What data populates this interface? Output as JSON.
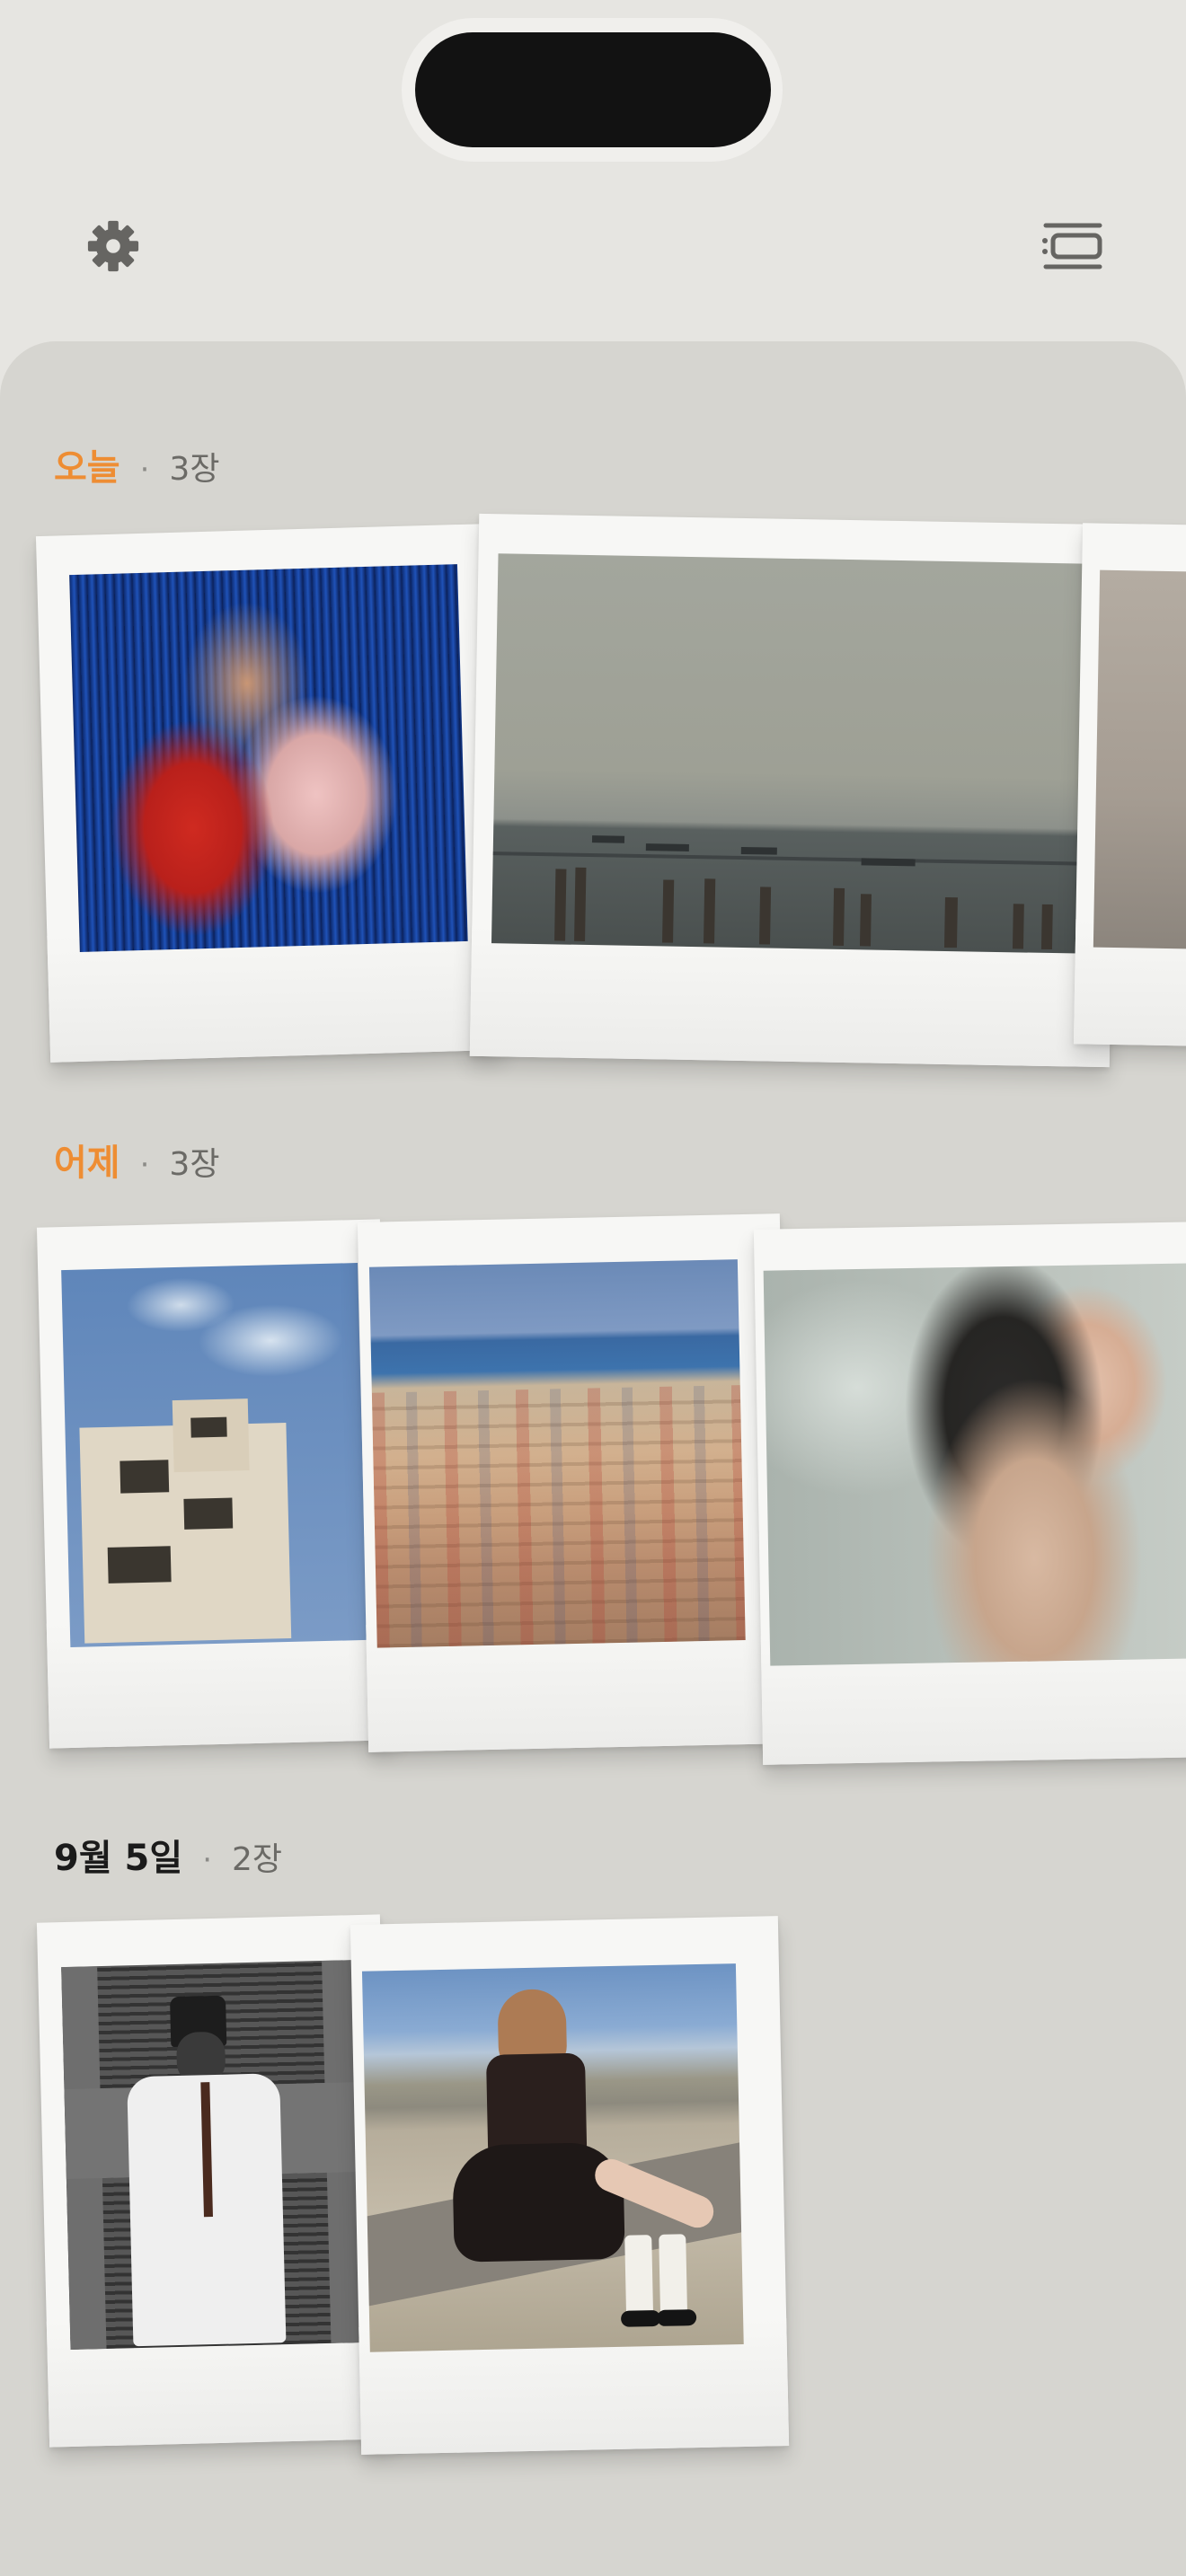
{
  "toolbar": {
    "settings_icon": "gear-icon",
    "list_icon": "list-view-icon"
  },
  "sections": [
    {
      "title": "오늘",
      "separator": "·",
      "count": "3장"
    },
    {
      "title": "어제",
      "separator": "·",
      "count": "3장"
    },
    {
      "title": "9월 5일",
      "separator": "·",
      "count": "2장"
    }
  ],
  "colors": {
    "accent": "#ee8d33",
    "background": "#e6e5e1",
    "panel": "#d6d5d0",
    "frame": "#f7f7f5"
  }
}
